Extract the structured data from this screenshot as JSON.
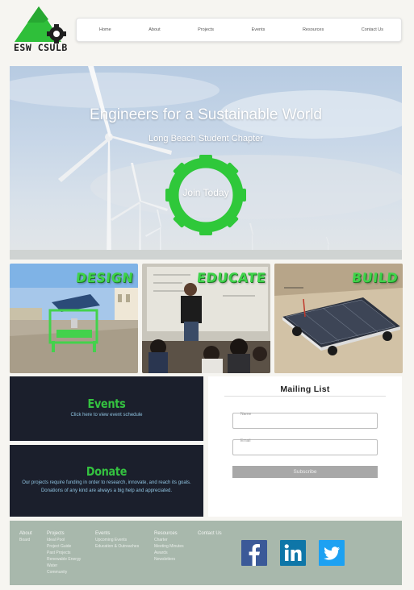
{
  "logo": {
    "text": "ESW CSULB"
  },
  "nav": {
    "items": [
      {
        "label": "Home"
      },
      {
        "label": "About"
      },
      {
        "label": "Projects"
      },
      {
        "label": "Events"
      },
      {
        "label": "Resources"
      },
      {
        "label": "Contact Us"
      }
    ]
  },
  "hero": {
    "title": "Engineers for a Sustainable World",
    "subtitle": "Long Beach Student Chapter",
    "cta_label": "Join Today"
  },
  "tiles": [
    {
      "label": "DESIGN"
    },
    {
      "label": "EDUCATE"
    },
    {
      "label": "BUILD"
    }
  ],
  "events": {
    "heading": "Events",
    "text": "Click here to view event schedule"
  },
  "donate": {
    "heading": "Donate",
    "text": "Our projects require funding in order to research, innovate, and reach its goals. Donations of any kind are always a big help and appreciated."
  },
  "mailing_list": {
    "title": "Mailing List",
    "name_label": "Name",
    "email_label": "Email",
    "subscribe_label": "Subscribe"
  },
  "footer": {
    "columns": [
      {
        "heading": "About",
        "links": [
          "Board"
        ]
      },
      {
        "heading": "Projects",
        "links": [
          "Ideal Pool",
          "Project Guide",
          "Past Projects",
          "Renewable Energy",
          "Water",
          "Community"
        ]
      },
      {
        "heading": "Events",
        "links": [
          "Upcoming Events",
          "Education & Outreaches"
        ]
      },
      {
        "heading": "Resources",
        "links": [
          "Charter",
          "Meeting Minutes",
          "Awards",
          "Newsletters"
        ]
      },
      {
        "heading": "Contact Us",
        "links": []
      }
    ],
    "social": [
      {
        "icon": "facebook-icon"
      },
      {
        "icon": "linkedin-icon"
      },
      {
        "icon": "twitter-icon"
      }
    ]
  },
  "colors": {
    "brand_green": "#34c240",
    "dark_navy": "#1b1f2c",
    "footer_bg": "#a8b8ac",
    "facebook": "#3b5998",
    "linkedin": "#0e76a8",
    "twitter": "#1da1f2"
  }
}
